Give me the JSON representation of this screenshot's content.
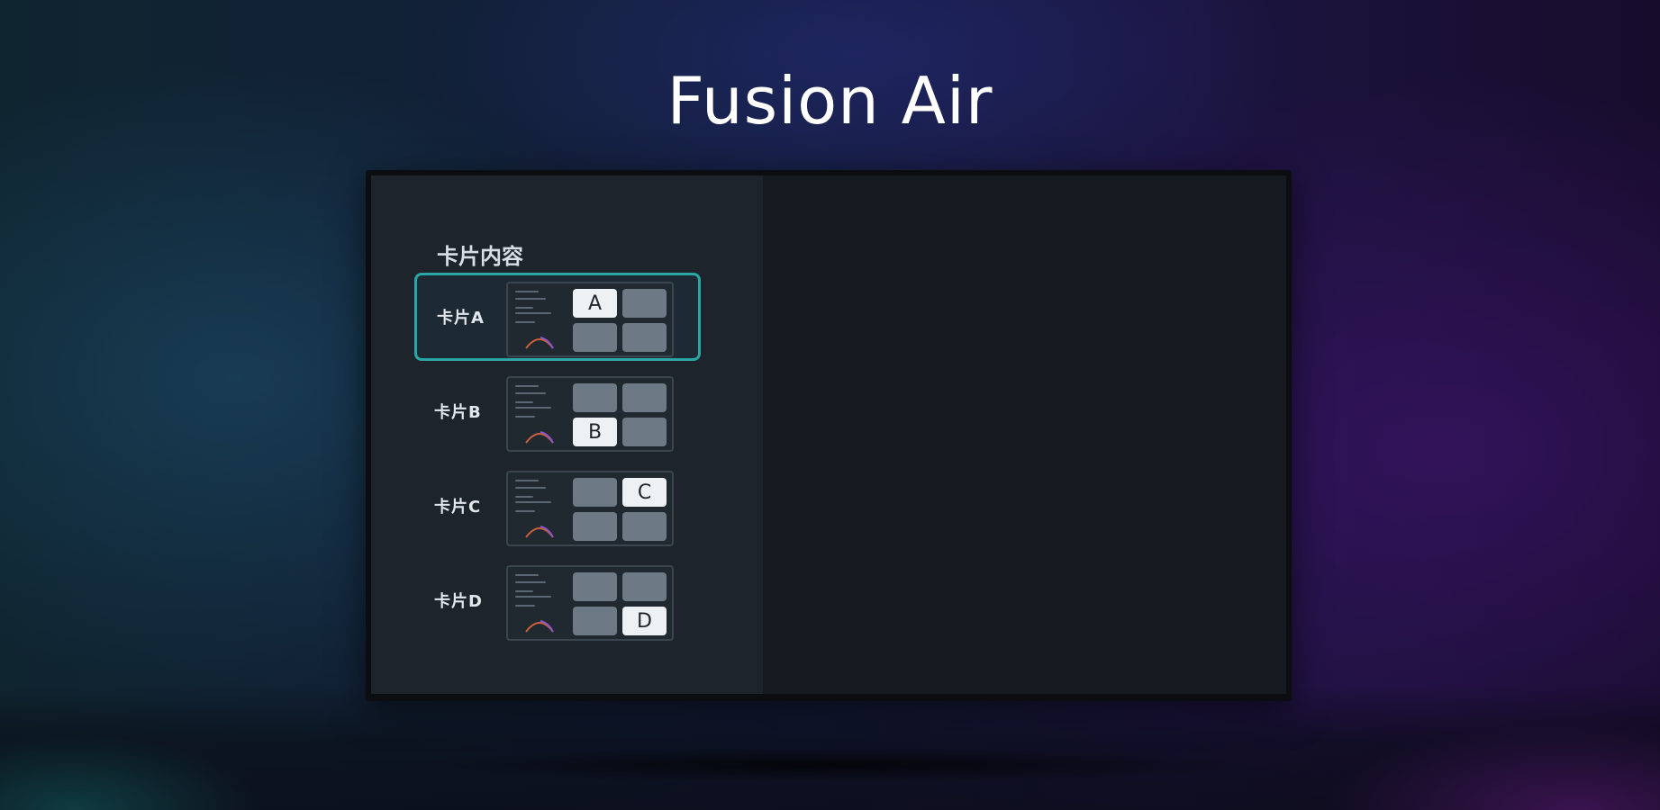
{
  "app": {
    "title": "Fusion Air"
  },
  "panel": {
    "heading": "卡片内容",
    "options": [
      {
        "label": "卡片A",
        "tile_letter": "A",
        "active_tile": 0,
        "selected": true
      },
      {
        "label": "卡片B",
        "tile_letter": "B",
        "active_tile": 2,
        "selected": false
      },
      {
        "label": "卡片C",
        "tile_letter": "C",
        "active_tile": 1,
        "selected": false
      },
      {
        "label": "卡片D",
        "tile_letter": "D",
        "active_tile": 3,
        "selected": false
      }
    ]
  },
  "colors": {
    "selection_border": "#2aa6a6",
    "active_tile": "#eef1f4",
    "inactive_tile": "#6e7986"
  }
}
